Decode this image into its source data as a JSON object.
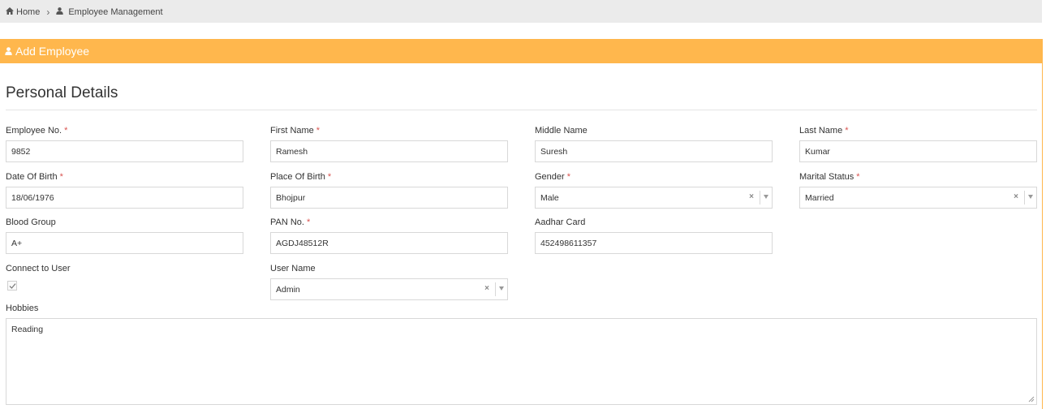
{
  "breadcrumb": {
    "home": "Home",
    "home_icon": "home-icon",
    "separator": "›",
    "current": "Employee Management",
    "current_icon": "user-icon"
  },
  "panel": {
    "title": "Add Employee",
    "title_icon": "user-icon",
    "accent_color": "#ffb74d"
  },
  "section": {
    "title": "Personal Details"
  },
  "required_marker": "*",
  "fields": {
    "employee_no": {
      "label": "Employee No.",
      "value": "9852"
    },
    "first_name": {
      "label": "First Name",
      "value": "Ramesh"
    },
    "middle_name": {
      "label": "Middle Name",
      "value": "Suresh"
    },
    "last_name": {
      "label": "Last Name",
      "value": "Kumar"
    },
    "dob": {
      "label": "Date Of Birth",
      "value": "18/06/1976"
    },
    "place_of_birth": {
      "label": "Place Of Birth",
      "value": "Bhojpur"
    },
    "gender": {
      "label": "Gender",
      "value": "Male"
    },
    "marital_status": {
      "label": "Marital Status",
      "value": "Married"
    },
    "blood_group": {
      "label": "Blood Group",
      "value": "A+"
    },
    "pan_no": {
      "label": "PAN No.",
      "value": "AGDJ48512R"
    },
    "aadhar": {
      "label": "Aadhar Card",
      "value": "452498611357"
    },
    "connect_user": {
      "label": "Connect to User",
      "checked": true
    },
    "user_name": {
      "label": "User Name",
      "value": "Admin"
    },
    "hobbies": {
      "label": "Hobbies",
      "value": "Reading"
    }
  },
  "select_clear_glyph": "×"
}
